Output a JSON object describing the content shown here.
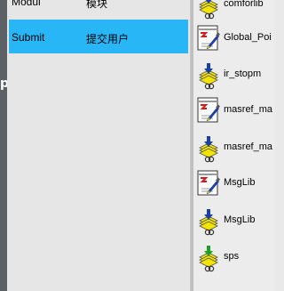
{
  "sidebar": {
    "glyph": "p"
  },
  "table": {
    "rows": [
      {
        "name": "Modul",
        "desc": "模块"
      },
      {
        "name": "Submit",
        "desc": "提交用户"
      }
    ]
  },
  "files": [
    {
      "label": "comforlib",
      "icon": "library-down-icon"
    },
    {
      "label": "Global_Poi",
      "icon": "form-icon"
    },
    {
      "label": "ir_stopm",
      "icon": "library-down-icon"
    },
    {
      "label": "masref_ma",
      "icon": "form-icon"
    },
    {
      "label": "masref_ma",
      "icon": "library-down-icon"
    },
    {
      "label": "MsgLib",
      "icon": "form-icon"
    },
    {
      "label": "MsgLib",
      "icon": "library-down-icon"
    },
    {
      "label": "sps",
      "icon": "library-down-green-icon"
    }
  ],
  "colors": {
    "selection": "#29b6f6",
    "arrow_blue": "#1a3fa8",
    "arrow_green": "#1ea024",
    "stack_yellow": "#f2e400"
  }
}
